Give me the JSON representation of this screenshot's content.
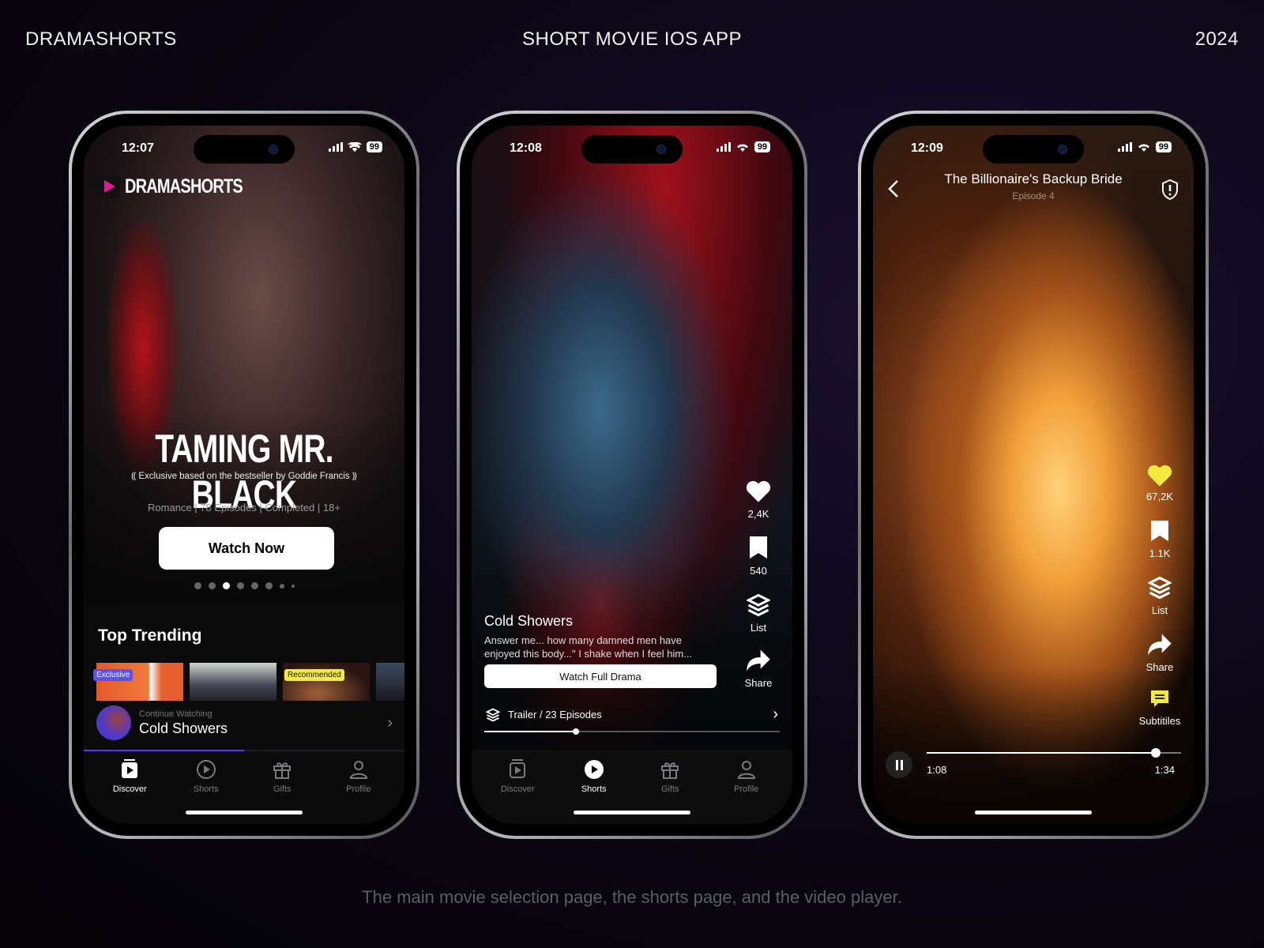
{
  "header": {
    "brand": "DRAMASHORTS",
    "title": "SHORT MOVIE IOS APP",
    "year": "2024"
  },
  "caption": "The main movie selection page, the shorts page, and the video player.",
  "colors": {
    "accent_purple": "#5b4ff5",
    "badge_yellow": "#f3ec3a",
    "like_yellow": "#f4ea3c"
  },
  "tabs": [
    "Discover",
    "Shorts",
    "Gifts",
    "Profile"
  ],
  "discover": {
    "status": {
      "time": "12:07",
      "battery": "99"
    },
    "logo": "DRAMASHORTS",
    "hero_title": "TAMING MR. BLACK",
    "hero_subtitle": "Exclusive based on the bestseller by Goddie Francis",
    "hero_meta": "Romance | 78 Episodes | Completed | 18+",
    "watch_now": "Watch Now",
    "carousel_active_index": 2,
    "carousel_count": 8,
    "section_title": "Top Trending",
    "badges": {
      "exclusive": "Exclusive",
      "recommended": "Recommended"
    },
    "continue_label": "Continue Watching",
    "continue_title": "Cold Showers",
    "continue_progress": 0.5,
    "active_tab": "Discover"
  },
  "shorts": {
    "status": {
      "time": "12:08",
      "battery": "99"
    },
    "likes": "2,4K",
    "saves": "540",
    "list_label": "List",
    "share_label": "Share",
    "title": "Cold Showers",
    "description": "Answer me... how many damned men have enjoyed this body...\" I shake when I feel him...",
    "watch_full": "Watch Full Drama",
    "episodes": "Trailer / 23 Episodes",
    "progress": 0.31,
    "active_tab": "Shorts"
  },
  "player": {
    "status": {
      "time": "12:09",
      "battery": "99"
    },
    "title": "The Billionaire's Backup Bride",
    "episode": "Episode 4",
    "likes": "67,2K",
    "saves": "1.1K",
    "list_label": "List",
    "share_label": "Share",
    "subtitles_label": "Subtitiles",
    "current_time": "1:08",
    "duration": "1:34",
    "progress": 0.9
  }
}
